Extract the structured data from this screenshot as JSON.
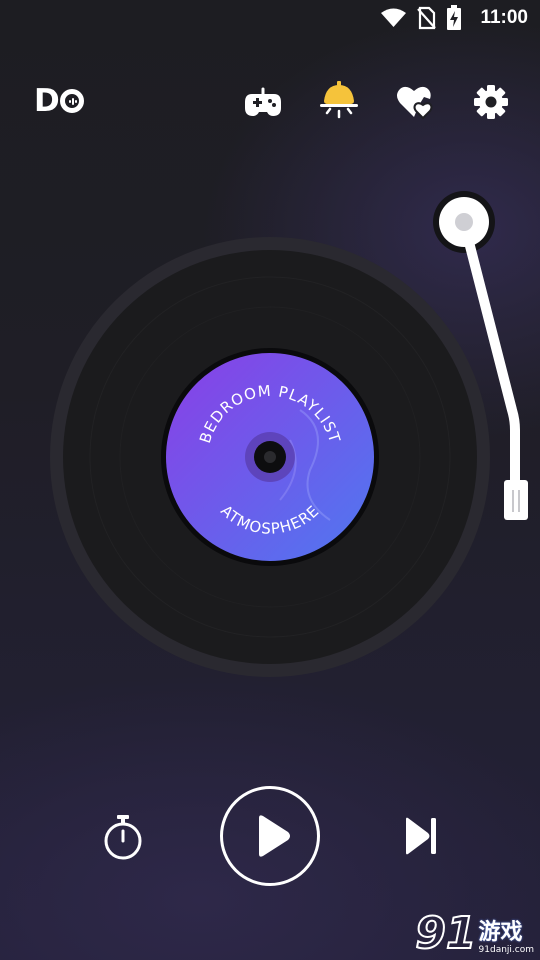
{
  "status_bar": {
    "time": "11:00",
    "icons": [
      "wifi-icon",
      "no-sim-icon",
      "battery-charging-icon"
    ]
  },
  "header": {
    "logo_text": "D",
    "buttons": [
      {
        "name": "gamepad-button",
        "icon": "gamepad-icon"
      },
      {
        "name": "night-light-button",
        "icon": "lamp-icon",
        "color": "#f5c33b"
      },
      {
        "name": "favorites-button",
        "icon": "heart-icon"
      },
      {
        "name": "settings-button",
        "icon": "gear-icon"
      }
    ]
  },
  "record": {
    "label_top": "BEDROOM PLAYLIST",
    "label_bottom": "ATMOSPHERE",
    "label_color_start": "#8a3fe6",
    "label_color_end": "#4f78f0"
  },
  "controls": {
    "timer": "timer-icon",
    "play": "play-icon",
    "next": "skip-next-icon"
  },
  "watermark": {
    "number": "91",
    "text": "游戏",
    "url": "91danji.com"
  }
}
